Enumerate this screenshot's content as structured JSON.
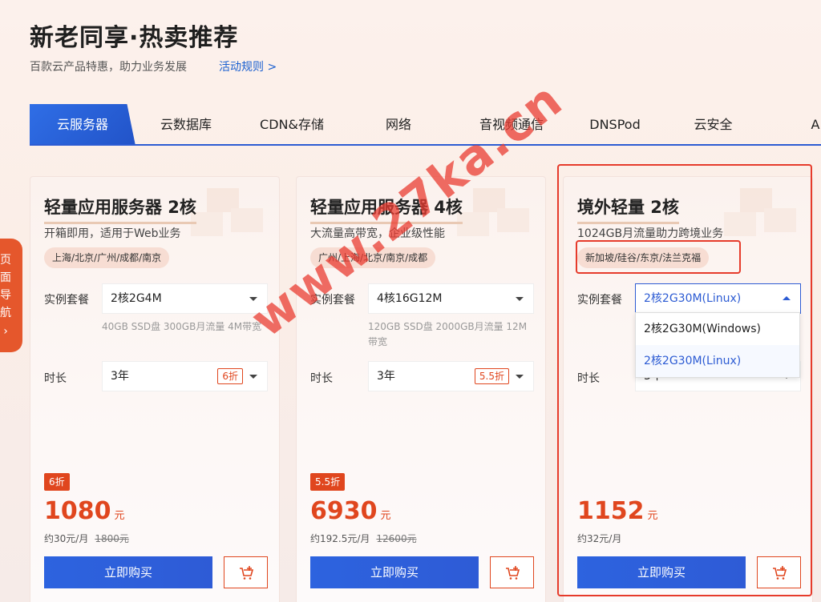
{
  "header": {
    "title": "新老同享·热卖推荐",
    "subtitle": "百款云产品特惠，助力业务发展",
    "rules_link": "活动规则 >"
  },
  "tabs": [
    {
      "label": "云服务器",
      "active": true
    },
    {
      "label": "云数据库"
    },
    {
      "label": "CDN&存储"
    },
    {
      "label": "网络"
    },
    {
      "label": "音视频通信"
    },
    {
      "label": "DNSPod"
    },
    {
      "label": "云安全"
    },
    {
      "label": "A"
    }
  ],
  "side_nav": {
    "chars": [
      "页",
      "面",
      "导",
      "航"
    ]
  },
  "labels": {
    "instance": "实例套餐",
    "duration": "时长",
    "buy": "立即购买",
    "price_unit": "元"
  },
  "cards": [
    {
      "title": "轻量应用服务器 2核",
      "desc": "开箱即用，适用于Web业务",
      "regions": "上海/北京/广州/成都/南京",
      "instance": "2核2G4M",
      "specs": "40GB SSD盘 300GB月流量 4M带宽",
      "duration": "3年",
      "discount": "6折",
      "price": "1080",
      "monthly": "约30元/月",
      "original": "1800元"
    },
    {
      "title": "轻量应用服务器 4核",
      "desc": "大流量高带宽，企业级性能",
      "regions": "广州/上海/北京/南京/成都",
      "instance": "4核16G12M",
      "specs": "120GB SSD盘 2000GB月流量 12M带宽",
      "duration": "3年",
      "discount": "5.5折",
      "price": "6930",
      "monthly": "约192.5元/月",
      "original": "12600元"
    },
    {
      "title": "境外轻量 2核",
      "desc": "1024GB月流量助力跨境业务",
      "regions": "新加坡/硅谷/东京/法兰克福",
      "instance": "2核2G30M(Linux)",
      "duration": "3年",
      "price": "1152",
      "monthly": "约32元/月"
    }
  ],
  "dropdown_options": [
    "2核2G30M(Windows)",
    "2核2G30M(Linux)"
  ],
  "watermark": "www.27ka.cn",
  "colors": {
    "accent_blue": "#2c5bd3",
    "accent_red": "#e0461e",
    "highlight_box": "#e63b2b"
  }
}
